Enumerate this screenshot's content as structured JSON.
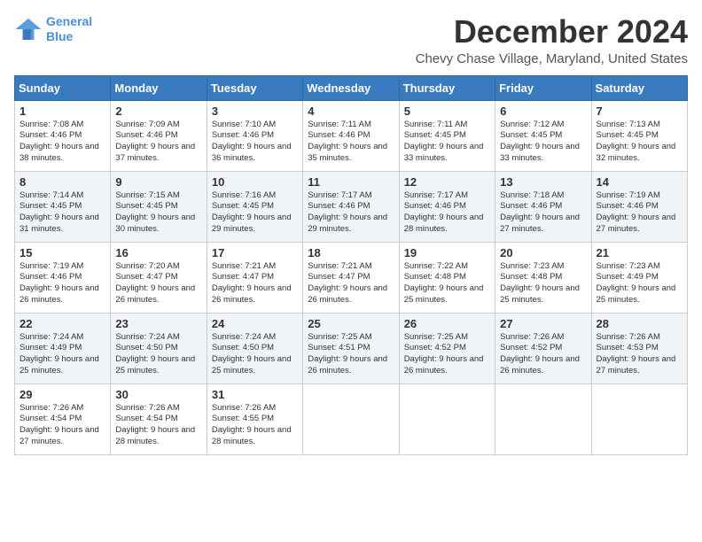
{
  "logo": {
    "line1": "General",
    "line2": "Blue"
  },
  "title": "December 2024",
  "subtitle": "Chevy Chase Village, Maryland, United States",
  "days_of_week": [
    "Sunday",
    "Monday",
    "Tuesday",
    "Wednesday",
    "Thursday",
    "Friday",
    "Saturday"
  ],
  "weeks": [
    [
      {
        "day": "1",
        "sunrise": "7:08 AM",
        "sunset": "4:46 PM",
        "daylight": "9 hours and 38 minutes."
      },
      {
        "day": "2",
        "sunrise": "7:09 AM",
        "sunset": "4:46 PM",
        "daylight": "9 hours and 37 minutes."
      },
      {
        "day": "3",
        "sunrise": "7:10 AM",
        "sunset": "4:46 PM",
        "daylight": "9 hours and 36 minutes."
      },
      {
        "day": "4",
        "sunrise": "7:11 AM",
        "sunset": "4:46 PM",
        "daylight": "9 hours and 35 minutes."
      },
      {
        "day": "5",
        "sunrise": "7:11 AM",
        "sunset": "4:45 PM",
        "daylight": "9 hours and 33 minutes."
      },
      {
        "day": "6",
        "sunrise": "7:12 AM",
        "sunset": "4:45 PM",
        "daylight": "9 hours and 33 minutes."
      },
      {
        "day": "7",
        "sunrise": "7:13 AM",
        "sunset": "4:45 PM",
        "daylight": "9 hours and 32 minutes."
      }
    ],
    [
      {
        "day": "8",
        "sunrise": "7:14 AM",
        "sunset": "4:45 PM",
        "daylight": "9 hours and 31 minutes."
      },
      {
        "day": "9",
        "sunrise": "7:15 AM",
        "sunset": "4:45 PM",
        "daylight": "9 hours and 30 minutes."
      },
      {
        "day": "10",
        "sunrise": "7:16 AM",
        "sunset": "4:45 PM",
        "daylight": "9 hours and 29 minutes."
      },
      {
        "day": "11",
        "sunrise": "7:17 AM",
        "sunset": "4:46 PM",
        "daylight": "9 hours and 29 minutes."
      },
      {
        "day": "12",
        "sunrise": "7:17 AM",
        "sunset": "4:46 PM",
        "daylight": "9 hours and 28 minutes."
      },
      {
        "day": "13",
        "sunrise": "7:18 AM",
        "sunset": "4:46 PM",
        "daylight": "9 hours and 27 minutes."
      },
      {
        "day": "14",
        "sunrise": "7:19 AM",
        "sunset": "4:46 PM",
        "daylight": "9 hours and 27 minutes."
      }
    ],
    [
      {
        "day": "15",
        "sunrise": "7:19 AM",
        "sunset": "4:46 PM",
        "daylight": "9 hours and 26 minutes."
      },
      {
        "day": "16",
        "sunrise": "7:20 AM",
        "sunset": "4:47 PM",
        "daylight": "9 hours and 26 minutes."
      },
      {
        "day": "17",
        "sunrise": "7:21 AM",
        "sunset": "4:47 PM",
        "daylight": "9 hours and 26 minutes."
      },
      {
        "day": "18",
        "sunrise": "7:21 AM",
        "sunset": "4:47 PM",
        "daylight": "9 hours and 26 minutes."
      },
      {
        "day": "19",
        "sunrise": "7:22 AM",
        "sunset": "4:48 PM",
        "daylight": "9 hours and 25 minutes."
      },
      {
        "day": "20",
        "sunrise": "7:23 AM",
        "sunset": "4:48 PM",
        "daylight": "9 hours and 25 minutes."
      },
      {
        "day": "21",
        "sunrise": "7:23 AM",
        "sunset": "4:49 PM",
        "daylight": "9 hours and 25 minutes."
      }
    ],
    [
      {
        "day": "22",
        "sunrise": "7:24 AM",
        "sunset": "4:49 PM",
        "daylight": "9 hours and 25 minutes."
      },
      {
        "day": "23",
        "sunrise": "7:24 AM",
        "sunset": "4:50 PM",
        "daylight": "9 hours and 25 minutes."
      },
      {
        "day": "24",
        "sunrise": "7:24 AM",
        "sunset": "4:50 PM",
        "daylight": "9 hours and 25 minutes."
      },
      {
        "day": "25",
        "sunrise": "7:25 AM",
        "sunset": "4:51 PM",
        "daylight": "9 hours and 26 minutes."
      },
      {
        "day": "26",
        "sunrise": "7:25 AM",
        "sunset": "4:52 PM",
        "daylight": "9 hours and 26 minutes."
      },
      {
        "day": "27",
        "sunrise": "7:26 AM",
        "sunset": "4:52 PM",
        "daylight": "9 hours and 26 minutes."
      },
      {
        "day": "28",
        "sunrise": "7:26 AM",
        "sunset": "4:53 PM",
        "daylight": "9 hours and 27 minutes."
      }
    ],
    [
      {
        "day": "29",
        "sunrise": "7:26 AM",
        "sunset": "4:54 PM",
        "daylight": "9 hours and 27 minutes."
      },
      {
        "day": "30",
        "sunrise": "7:26 AM",
        "sunset": "4:54 PM",
        "daylight": "9 hours and 28 minutes."
      },
      {
        "day": "31",
        "sunrise": "7:26 AM",
        "sunset": "4:55 PM",
        "daylight": "9 hours and 28 minutes."
      },
      null,
      null,
      null,
      null
    ]
  ]
}
